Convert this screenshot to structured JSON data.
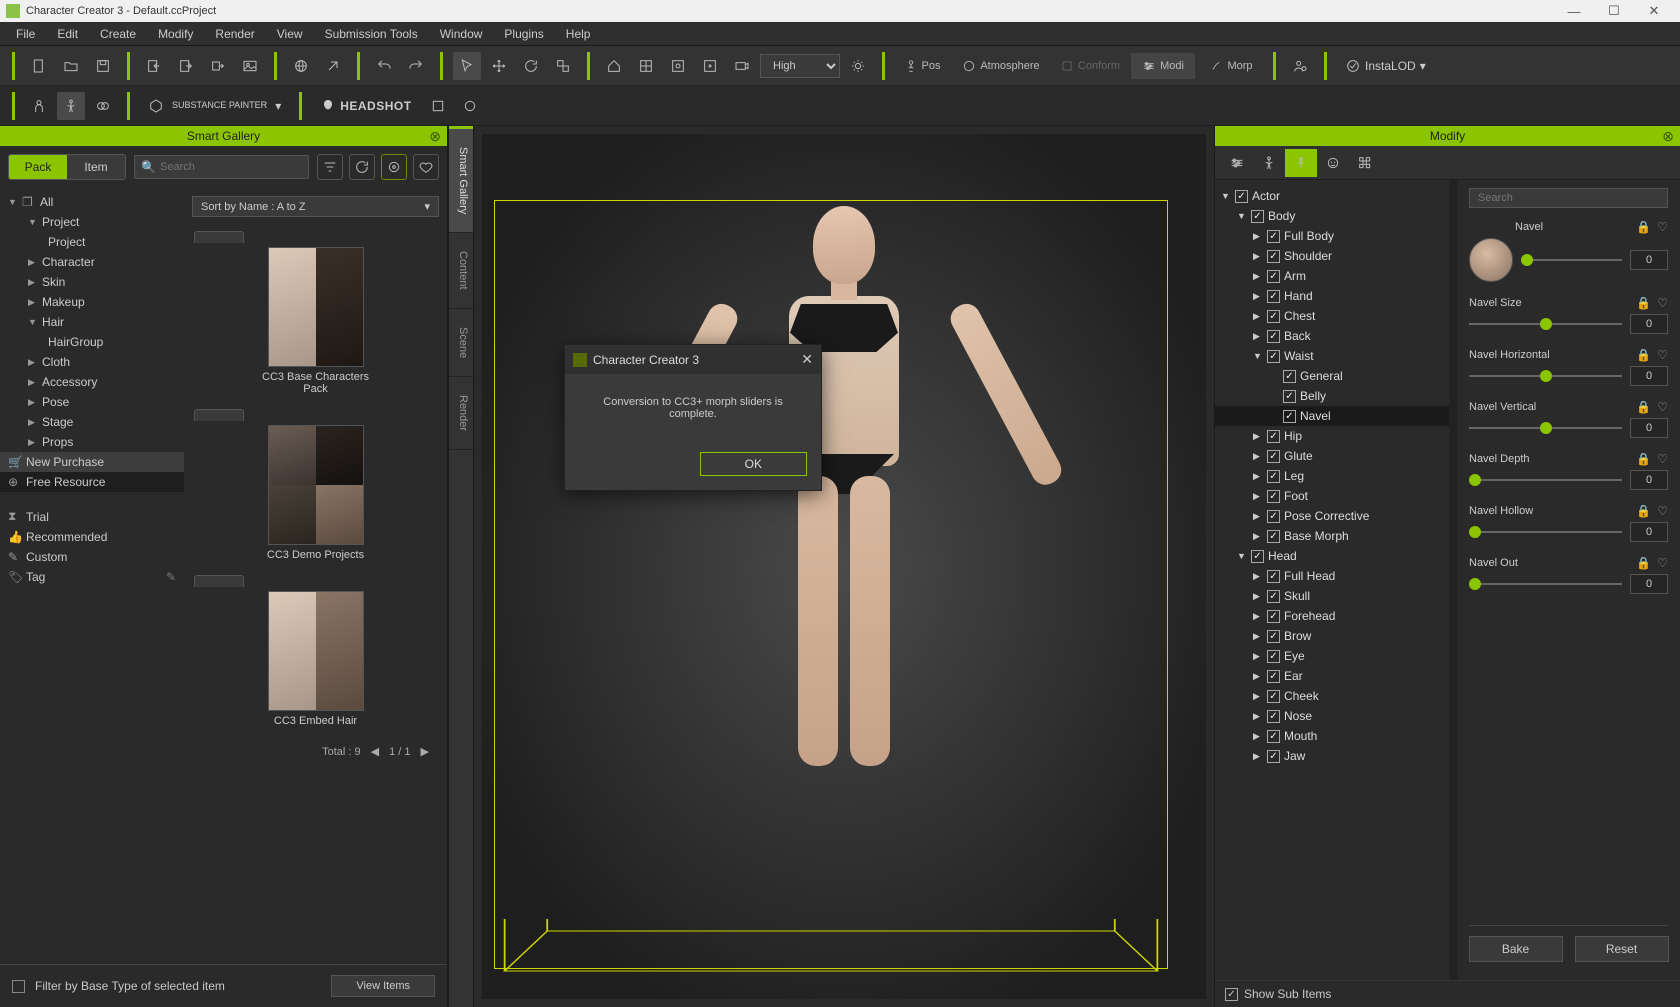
{
  "titlebar": {
    "text": "Character Creator 3 - Default.ccProject"
  },
  "menu": [
    "File",
    "Edit",
    "Create",
    "Modify",
    "Render",
    "View",
    "Submission Tools",
    "Window",
    "Plugins",
    "Help"
  ],
  "toolbar": {
    "quality": "High",
    "labels": {
      "pos": "Pos",
      "atmosphere": "Atmosphere",
      "conform": "Conform",
      "modify": "Modi",
      "morph": "Morp",
      "instalod": "InstaLOD"
    }
  },
  "toolbar2": {
    "substance": "SUBSTANCE PAINTER",
    "headshot": "HEADSHOT"
  },
  "smartGallery": {
    "title": "Smart Gallery",
    "tabs": {
      "pack": "Pack",
      "item": "Item"
    },
    "searchPlaceholder": "Search",
    "sort": "Sort by Name : A to Z",
    "tree": {
      "all": "All",
      "project": "Project",
      "projectChild": "Project",
      "character": "Character",
      "skin": "Skin",
      "makeup": "Makeup",
      "hair": "Hair",
      "hairgroup": "HairGroup",
      "cloth": "Cloth",
      "accessory": "Accessory",
      "pose": "Pose",
      "stage": "Stage",
      "props": "Props",
      "newPurchase": "New Purchase",
      "freeResource": "Free Resource",
      "trial": "Trial",
      "recommended": "Recommended",
      "custom": "Custom",
      "tag": "Tag"
    },
    "items": [
      {
        "label": "CC3 Base Characters Pack"
      },
      {
        "label": "CC3 Demo Projects"
      },
      {
        "label": "CC3 Embed Hair"
      }
    ],
    "footer": {
      "total": "Total : 9",
      "page": "1  /  1"
    },
    "filter": "Filter by Base Type of selected item",
    "viewItems": "View Items"
  },
  "vtabs": [
    "Smart Gallery",
    "Content",
    "Scene",
    "Render"
  ],
  "dialog": {
    "title": "Character Creator 3",
    "message": "Conversion to CC3+ morph sliders is complete.",
    "ok": "OK"
  },
  "modify": {
    "title": "Modify",
    "searchPlaceholder": "Search",
    "tree": [
      {
        "lvl": 0,
        "caret": "▼",
        "chk": true,
        "label": "Actor"
      },
      {
        "lvl": 1,
        "caret": "▼",
        "chk": true,
        "label": "Body"
      },
      {
        "lvl": 2,
        "caret": "▶",
        "chk": true,
        "label": "Full Body"
      },
      {
        "lvl": 2,
        "caret": "▶",
        "chk": true,
        "label": "Shoulder"
      },
      {
        "lvl": 2,
        "caret": "▶",
        "chk": true,
        "label": "Arm"
      },
      {
        "lvl": 2,
        "caret": "▶",
        "chk": true,
        "label": "Hand"
      },
      {
        "lvl": 2,
        "caret": "▶",
        "chk": true,
        "label": "Chest"
      },
      {
        "lvl": 2,
        "caret": "▶",
        "chk": true,
        "label": "Back"
      },
      {
        "lvl": 2,
        "caret": "▼",
        "chk": true,
        "label": "Waist"
      },
      {
        "lvl": 3,
        "caret": "",
        "chk": true,
        "label": "General"
      },
      {
        "lvl": 3,
        "caret": "",
        "chk": true,
        "label": "Belly"
      },
      {
        "lvl": 3,
        "caret": "",
        "chk": true,
        "label": "Navel",
        "sel": true
      },
      {
        "lvl": 2,
        "caret": "▶",
        "chk": true,
        "label": "Hip"
      },
      {
        "lvl": 2,
        "caret": "▶",
        "chk": true,
        "label": "Glute"
      },
      {
        "lvl": 2,
        "caret": "▶",
        "chk": true,
        "label": "Leg"
      },
      {
        "lvl": 2,
        "caret": "▶",
        "chk": true,
        "label": "Foot"
      },
      {
        "lvl": 2,
        "caret": "▶",
        "chk": true,
        "label": "Pose Corrective"
      },
      {
        "lvl": 2,
        "caret": "▶",
        "chk": true,
        "label": "Base Morph"
      },
      {
        "lvl": 1,
        "caret": "▼",
        "chk": true,
        "label": "Head"
      },
      {
        "lvl": 2,
        "caret": "▶",
        "chk": true,
        "label": "Full Head"
      },
      {
        "lvl": 2,
        "caret": "▶",
        "chk": true,
        "label": "Skull"
      },
      {
        "lvl": 2,
        "caret": "▶",
        "chk": true,
        "label": "Forehead"
      },
      {
        "lvl": 2,
        "caret": "▶",
        "chk": true,
        "label": "Brow"
      },
      {
        "lvl": 2,
        "caret": "▶",
        "chk": true,
        "label": "Eye"
      },
      {
        "lvl": 2,
        "caret": "▶",
        "chk": true,
        "label": "Ear"
      },
      {
        "lvl": 2,
        "caret": "▶",
        "chk": true,
        "label": "Cheek"
      },
      {
        "lvl": 2,
        "caret": "▶",
        "chk": true,
        "label": "Nose"
      },
      {
        "lvl": 2,
        "caret": "▶",
        "chk": true,
        "label": "Mouth"
      },
      {
        "lvl": 2,
        "caret": "▶",
        "chk": true,
        "label": "Jaw"
      }
    ],
    "sliders": [
      {
        "label": "Navel",
        "value": "0",
        "pos": 6,
        "avatar": true
      },
      {
        "label": "Navel Size",
        "value": "0",
        "pos": 50
      },
      {
        "label": "Navel Horizontal",
        "value": "0",
        "pos": 50
      },
      {
        "label": "Navel Vertical",
        "value": "0",
        "pos": 50
      },
      {
        "label": "Navel Depth",
        "value": "0",
        "pos": 4
      },
      {
        "label": "Navel Hollow",
        "value": "0",
        "pos": 4
      },
      {
        "label": "Navel Out",
        "value": "0",
        "pos": 4
      }
    ],
    "bake": "Bake",
    "reset": "Reset",
    "showSub": "Show Sub Items"
  }
}
